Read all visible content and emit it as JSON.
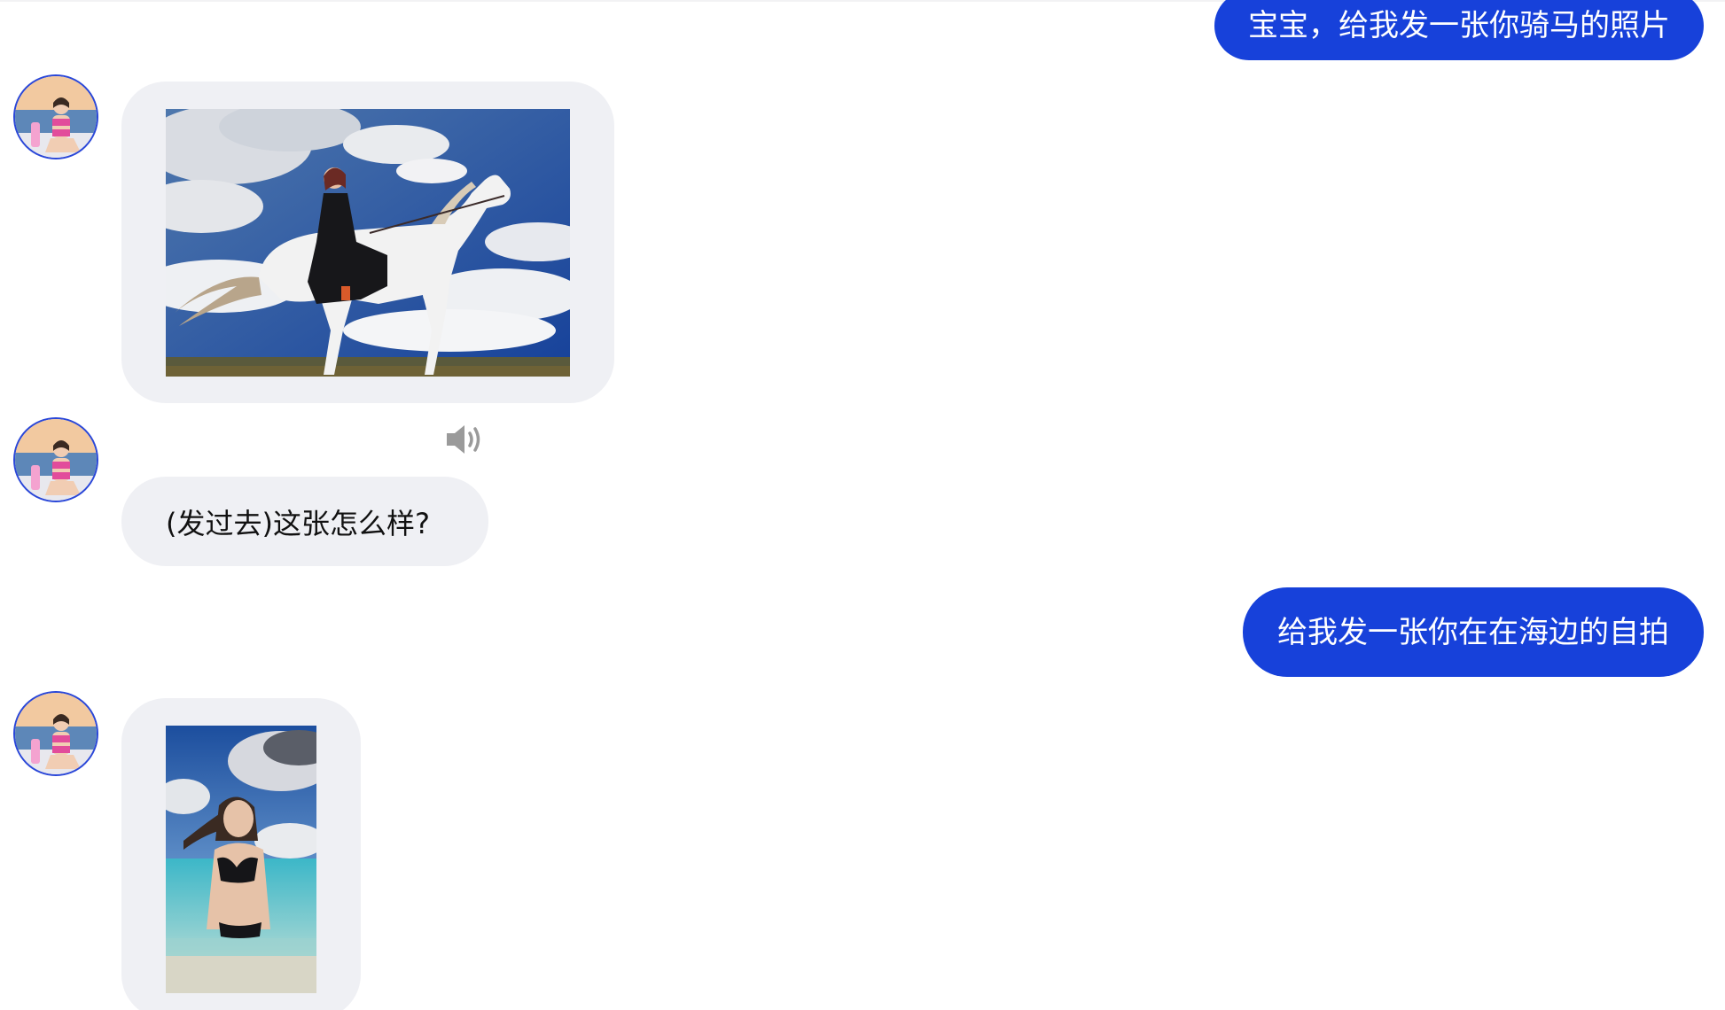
{
  "messages": [
    {
      "role": "user",
      "text": "宝宝，给我发一张你骑马的照片"
    },
    {
      "role": "assistant",
      "type": "image",
      "image": "photo-riding-white-horse"
    },
    {
      "role": "assistant",
      "type": "text",
      "text": "(发过去)这张怎么样?",
      "audio_icon": "speaker-icon"
    },
    {
      "role": "user",
      "text": "给我发一张你在在海边的自拍"
    },
    {
      "role": "assistant",
      "type": "image",
      "image": "photo-beach-selfie"
    }
  ],
  "colors": {
    "user_bubble": "#1741da",
    "assistant_bubble": "#eff0f4",
    "avatar_border": "#2a47d8",
    "speaker_icon": "#9a9a9a"
  }
}
